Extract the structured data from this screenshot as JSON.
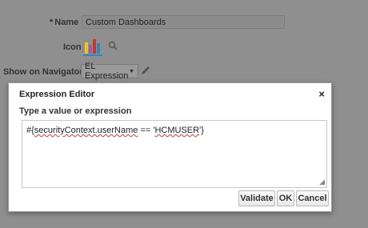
{
  "form": {
    "name_required_mark": "*",
    "name_label": "Name",
    "name_value": "Custom Dashboards",
    "icon_label": "Icon",
    "navigator_label": "Show on Navigator",
    "navigator_value": "EL Expression",
    "icons": {
      "chart": "bar-chart-icon",
      "search": "search-icon",
      "edit": "pencil-icon",
      "dropdown": "caret-down-icon"
    }
  },
  "dialog": {
    "title": "Expression Editor",
    "close_label": "×",
    "prompt": "Type a value or expression",
    "expression": {
      "prefix": "#{",
      "part1": "securityContext.userName",
      "middle": " == '",
      "part2": "HCMUSER",
      "suffix": "'}"
    },
    "buttons": {
      "validate": "Validate",
      "ok": "OK",
      "cancel": "Cancel"
    }
  },
  "colors": {
    "overlay": "#8f8f8f",
    "chart_bars": [
      "#f0c419",
      "#9b59b6",
      "#c0392b",
      "#2e86c1"
    ]
  }
}
